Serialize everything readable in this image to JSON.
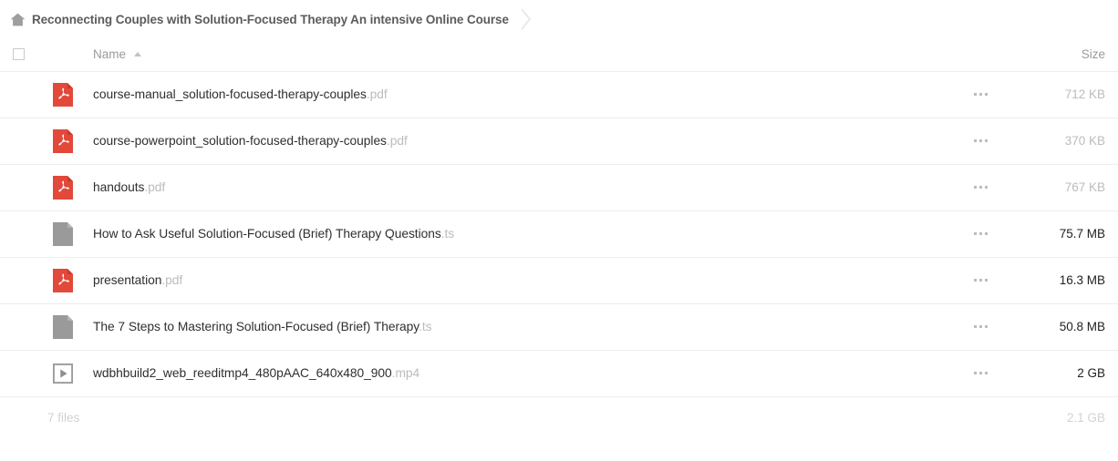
{
  "breadcrumb": {
    "home_icon": "home-icon",
    "title": "Reconnecting Couples with Solution-Focused Therapy An intensive Online Course",
    "separator_icon": "chevron-right-icon"
  },
  "table": {
    "headers": {
      "select_all": "",
      "name": "Name",
      "sort_direction": "ascending",
      "size": "Size"
    },
    "menu_label": "⋯",
    "rows": [
      {
        "icon": "pdf-file-icon",
        "name": "course-manual_solution-focused-therapy-couples",
        "ext": ".pdf",
        "size": "712 KB",
        "size_emphasis": "light"
      },
      {
        "icon": "pdf-file-icon",
        "name": "course-powerpoint_solution-focused-therapy-couples",
        "ext": ".pdf",
        "size": "370 KB",
        "size_emphasis": "light"
      },
      {
        "icon": "pdf-file-icon",
        "name": "handouts",
        "ext": ".pdf",
        "size": "767 KB",
        "size_emphasis": "light"
      },
      {
        "icon": "generic-file-icon",
        "name": "How to Ask Useful Solution-Focused (Brief) Therapy Questions",
        "ext": ".ts",
        "size": "75.7 MB",
        "size_emphasis": "dark"
      },
      {
        "icon": "pdf-file-icon",
        "name": "presentation",
        "ext": ".pdf",
        "size": "16.3 MB",
        "size_emphasis": "dark"
      },
      {
        "icon": "generic-file-icon",
        "name": "The 7 Steps to Mastering Solution-Focused (Brief) Therapy",
        "ext": ".ts",
        "size": "50.8 MB",
        "size_emphasis": "dark"
      },
      {
        "icon": "video-file-icon",
        "name": "wdbhbuild2_web_reeditmp4_480pAAC_640x480_900",
        "ext": ".mp4",
        "size": "2 GB",
        "size_emphasis": "dark"
      }
    ]
  },
  "footer": {
    "file_count": "7 files",
    "total_size": "2.1 GB"
  },
  "colors": {
    "pdf_red": "#e2493a",
    "generic_gray": "#9a9a9a",
    "text_dark": "#2f2f2f",
    "text_muted": "#bcbcbc",
    "border": "#ededed"
  }
}
